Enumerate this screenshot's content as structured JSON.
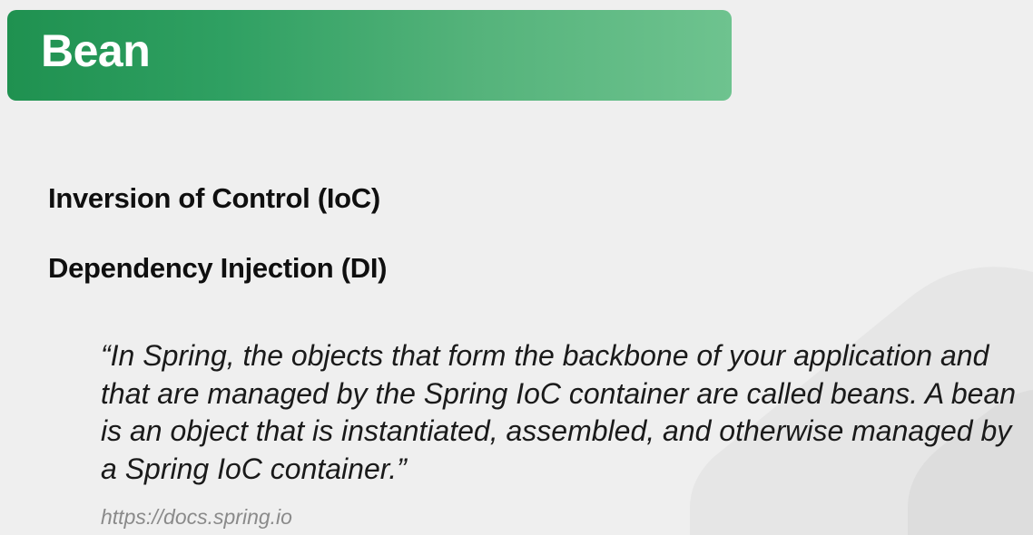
{
  "slide": {
    "title": "Bean",
    "topics": [
      "Inversion of Control (IoC)",
      "Dependency Injection (DI)"
    ],
    "quote": "“In Spring, the objects that form the backbone of your application and that are managed by the Spring IoC container are called beans. A bean is an object that is instantiated, assembled, and otherwise managed by a Spring IoC container.”",
    "source": "https://docs.spring.io"
  },
  "colors": {
    "header_start": "#1f9150",
    "header_end": "#6ec38f",
    "background": "#efefef",
    "source_text": "#8a8a8a"
  }
}
